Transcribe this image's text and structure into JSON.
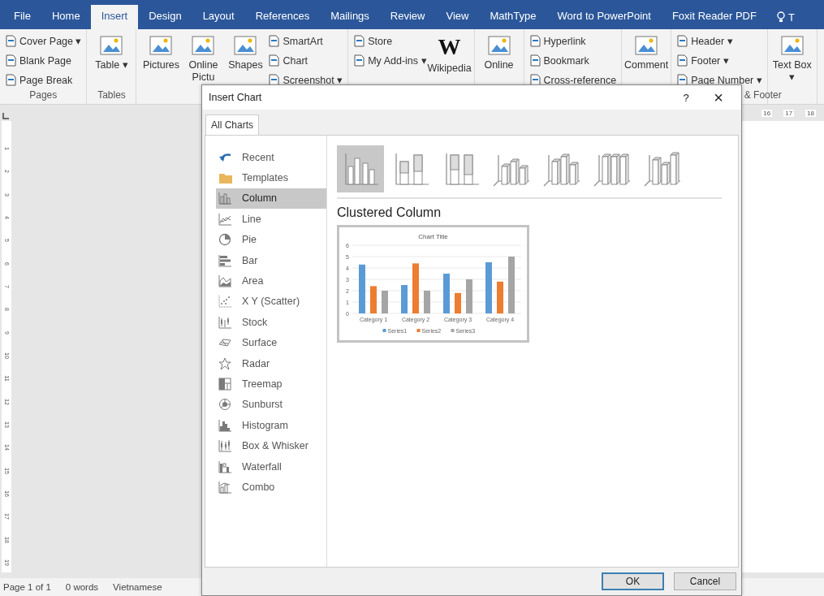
{
  "ribbon_tabs": [
    {
      "label": "File",
      "selected": false
    },
    {
      "label": "Home",
      "selected": false
    },
    {
      "label": "Insert",
      "selected": true
    },
    {
      "label": "Design",
      "selected": false
    },
    {
      "label": "Layout",
      "selected": false
    },
    {
      "label": "References",
      "selected": false
    },
    {
      "label": "Mailings",
      "selected": false
    },
    {
      "label": "Review",
      "selected": false
    },
    {
      "label": "View",
      "selected": false
    },
    {
      "label": "MathType",
      "selected": false
    },
    {
      "label": "Word to PowerPoint",
      "selected": false
    },
    {
      "label": "Foxit Reader PDF",
      "selected": false
    }
  ],
  "tell_me": {
    "label": "T"
  },
  "ribbon_groups": [
    {
      "label": "Pages",
      "buttons": [
        {
          "kind": "small",
          "label": "Cover Page ▾"
        },
        {
          "kind": "small",
          "label": "Blank Page"
        },
        {
          "kind": "small",
          "label": "Page Break"
        }
      ]
    },
    {
      "label": "Tables",
      "buttons": [
        {
          "kind": "large",
          "label": "Table ▾"
        }
      ]
    },
    {
      "buttons": [
        {
          "kind": "large",
          "label": "Pictures"
        },
        {
          "kind": "large",
          "label": "Online Pictu"
        },
        {
          "kind": "large",
          "label": "Shapes"
        },
        {
          "kind": "small",
          "label": "SmartArt"
        },
        {
          "kind": "small",
          "label": "Chart"
        },
        {
          "kind": "small",
          "label": "Screenshot ▾"
        }
      ]
    },
    {
      "buttons": [
        {
          "kind": "small",
          "label": "Store"
        },
        {
          "kind": "small",
          "label": "My Add-ins ▾"
        },
        {
          "kind": "large",
          "label": "Wikipedia",
          "glyph": "W"
        }
      ]
    },
    {
      "buttons": [
        {
          "kind": "large",
          "label": "Online"
        }
      ]
    },
    {
      "buttons": [
        {
          "kind": "small",
          "label": "Hyperlink"
        },
        {
          "kind": "small",
          "label": "Bookmark"
        },
        {
          "kind": "small",
          "label": "Cross-reference"
        }
      ]
    },
    {
      "buttons": [
        {
          "kind": "large",
          "label": "Comment"
        }
      ]
    },
    {
      "label": "& Footer",
      "buttons": [
        {
          "kind": "small",
          "label": "Header ▾"
        },
        {
          "kind": "small",
          "label": "Footer ▾"
        },
        {
          "kind": "small",
          "label": "Page Number ▾"
        }
      ]
    },
    {
      "buttons": [
        {
          "kind": "large",
          "label": "Text Box ▾"
        }
      ]
    }
  ],
  "horizontal_ruler": [
    "16",
    "17",
    "18"
  ],
  "vertical_ruler": [
    "1",
    "2",
    "3",
    "4",
    "5",
    "6",
    "7",
    "8",
    "9",
    "10",
    "11",
    "12",
    "13",
    "14",
    "15",
    "16",
    "17",
    "18",
    "19"
  ],
  "status_bar": [
    "Page 1 of 1",
    "0 words",
    "Vietnamese"
  ],
  "dialog": {
    "title": "Insert Chart",
    "help": "?",
    "close": "×",
    "tabs": [
      {
        "label": "All Charts",
        "selected": true
      }
    ],
    "chart_types": [
      {
        "label": "Recent",
        "selected": false
      },
      {
        "label": "Templates",
        "selected": false
      },
      {
        "label": "Column",
        "selected": true
      },
      {
        "label": "Line",
        "selected": false
      },
      {
        "label": "Pie",
        "selected": false
      },
      {
        "label": "Bar",
        "selected": false
      },
      {
        "label": "Area",
        "selected": false
      },
      {
        "label": "X Y (Scatter)",
        "selected": false
      },
      {
        "label": "Stock",
        "selected": false
      },
      {
        "label": "Surface",
        "selected": false
      },
      {
        "label": "Radar",
        "selected": false
      },
      {
        "label": "Treemap",
        "selected": false
      },
      {
        "label": "Sunburst",
        "selected": false
      },
      {
        "label": "Histogram",
        "selected": false
      },
      {
        "label": "Box & Whisker",
        "selected": false
      },
      {
        "label": "Waterfall",
        "selected": false
      },
      {
        "label": "Combo",
        "selected": false
      }
    ],
    "subtypes": [
      {
        "kind": "clustered",
        "selected": true
      },
      {
        "kind": "stacked",
        "selected": false
      },
      {
        "kind": "stacked100",
        "selected": false
      },
      {
        "kind": "clustered3d",
        "selected": false
      },
      {
        "kind": "stacked3d",
        "selected": false
      },
      {
        "kind": "stacked100_3d",
        "selected": false
      },
      {
        "kind": "column3d",
        "selected": false
      }
    ],
    "subtype_title": "Clustered Column",
    "preview": {
      "chart_data": {
        "type": "bar",
        "title": "Chart Title",
        "categories": [
          "Category 1",
          "Category 2",
          "Category 3",
          "Category 4"
        ],
        "series": [
          {
            "name": "Series1",
            "color": "#5b9bd5",
            "values": [
              4.3,
              2.5,
              3.5,
              4.5
            ]
          },
          {
            "name": "Series2",
            "color": "#ed7d31",
            "values": [
              2.4,
              4.4,
              1.8,
              2.8
            ]
          },
          {
            "name": "Series3",
            "color": "#a5a5a5",
            "values": [
              2,
              2,
              3,
              5
            ]
          }
        ],
        "ylim": [
          0,
          6
        ],
        "yticks": [
          0,
          1,
          2,
          3,
          4,
          5,
          6
        ],
        "grid": true,
        "legend": true
      }
    },
    "buttons": [
      {
        "label": "OK",
        "default": true
      },
      {
        "label": "Cancel",
        "default": false
      }
    ]
  }
}
